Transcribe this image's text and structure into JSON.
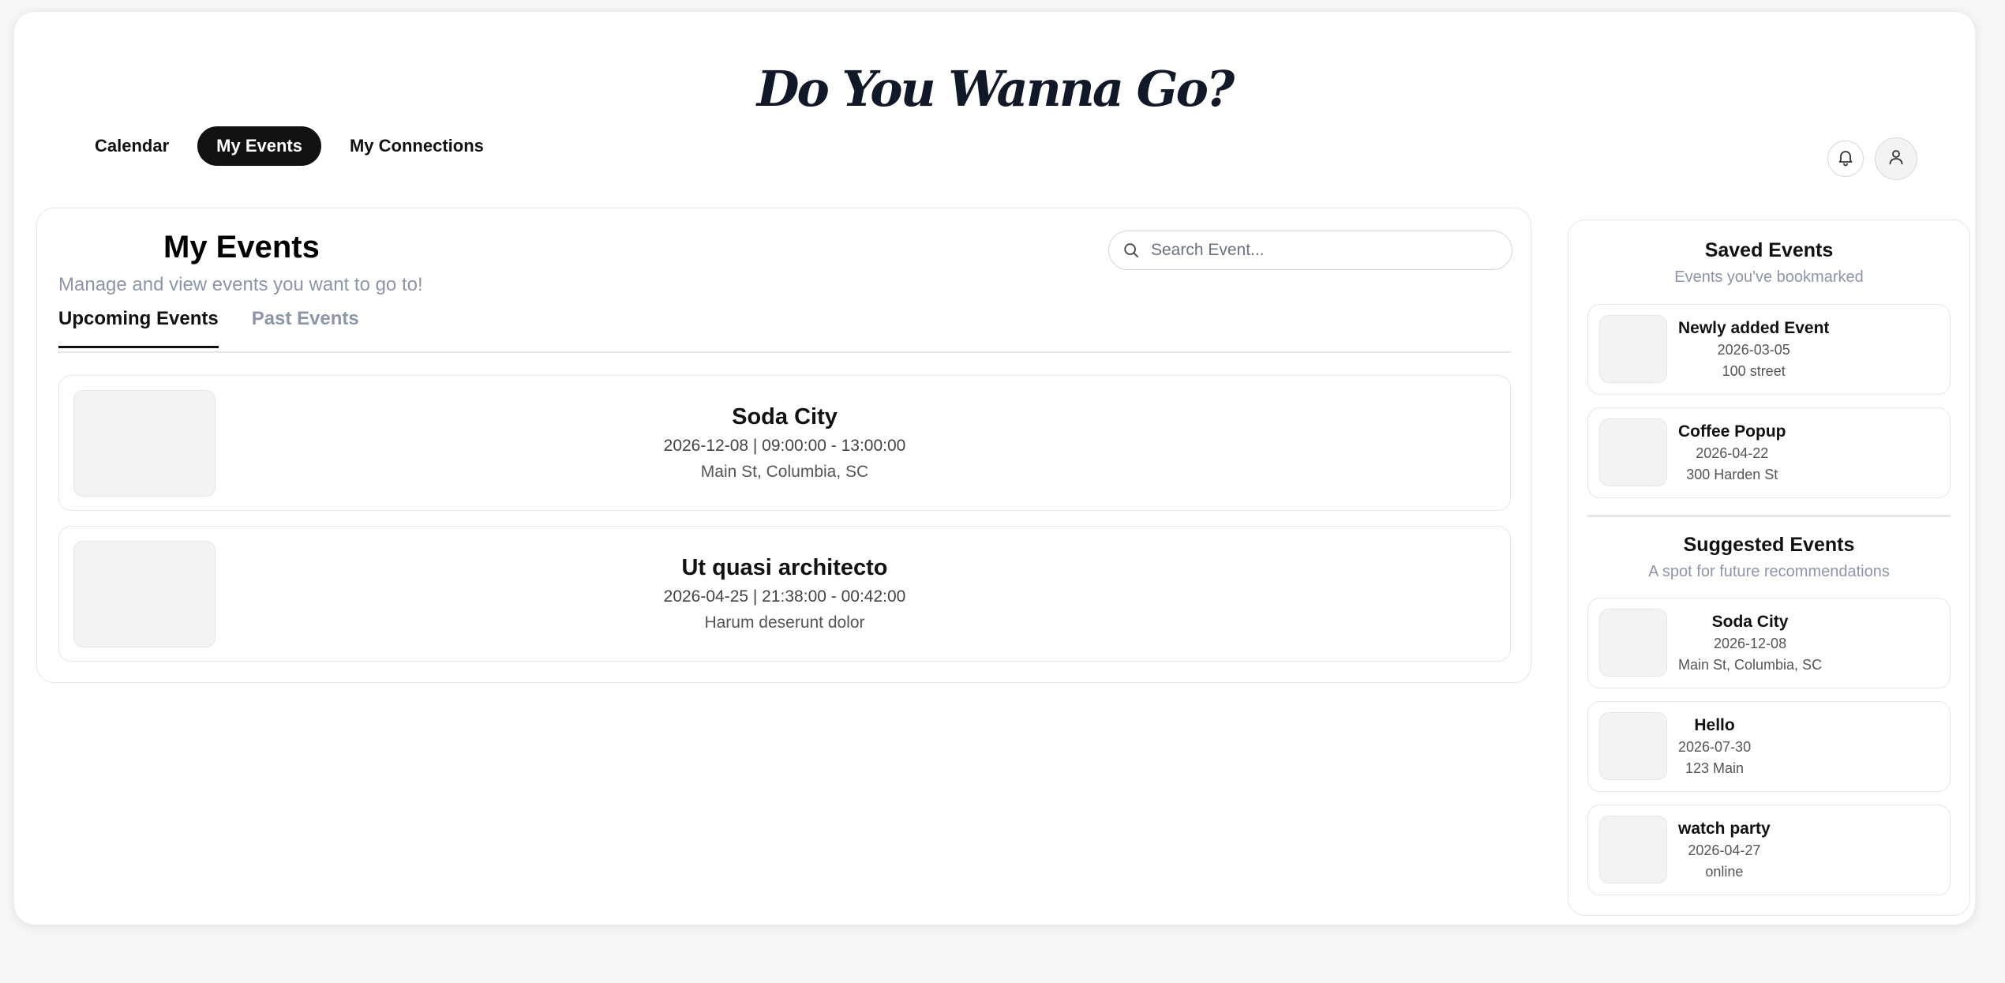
{
  "brand": {
    "title": "Do You Wanna Go?"
  },
  "nav": {
    "tabs": [
      {
        "label": "Calendar"
      },
      {
        "label": "My Events"
      },
      {
        "label": "My Connections"
      }
    ]
  },
  "header_icons": {
    "notifications": "bell-icon",
    "profile": "user-icon"
  },
  "main": {
    "title": "My Events",
    "subtitle": "Manage and view events you want to go to!",
    "search": {
      "placeholder": "Search Event...",
      "value": ""
    },
    "tabs": [
      {
        "label": "Upcoming Events"
      },
      {
        "label": "Past Events"
      }
    ],
    "events": [
      {
        "title": "Soda City",
        "when": "2026-12-08 | 09:00:00 - 13:00:00",
        "where": "Main St, Columbia, SC"
      },
      {
        "title": "Ut quasi architecto",
        "when": "2026-04-25 | 21:38:00 - 00:42:00",
        "where": "Harum deserunt dolor"
      }
    ]
  },
  "sidebar": {
    "saved": {
      "title": "Saved Events",
      "subtitle": "Events you've bookmarked",
      "items": [
        {
          "title": "Newly added Event",
          "date": "2026-03-05",
          "location": "100 street"
        },
        {
          "title": "Coffee Popup",
          "date": "2026-04-22",
          "location": "300 Harden St"
        }
      ]
    },
    "suggested": {
      "title": "Suggested Events",
      "subtitle": "A spot for future recommendations",
      "items": [
        {
          "title": "Soda City",
          "date": "2026-12-08",
          "location": "Main St, Columbia, SC"
        },
        {
          "title": "Hello",
          "date": "2026-07-30",
          "location": "123 Main"
        },
        {
          "title": "watch party",
          "date": "2026-04-27",
          "location": "online"
        }
      ]
    }
  },
  "colors": {
    "accent": "#111111",
    "muted_text": "#8d95a8",
    "border": "#e6e6e9",
    "thumb_bg": "#f2f3f5"
  }
}
